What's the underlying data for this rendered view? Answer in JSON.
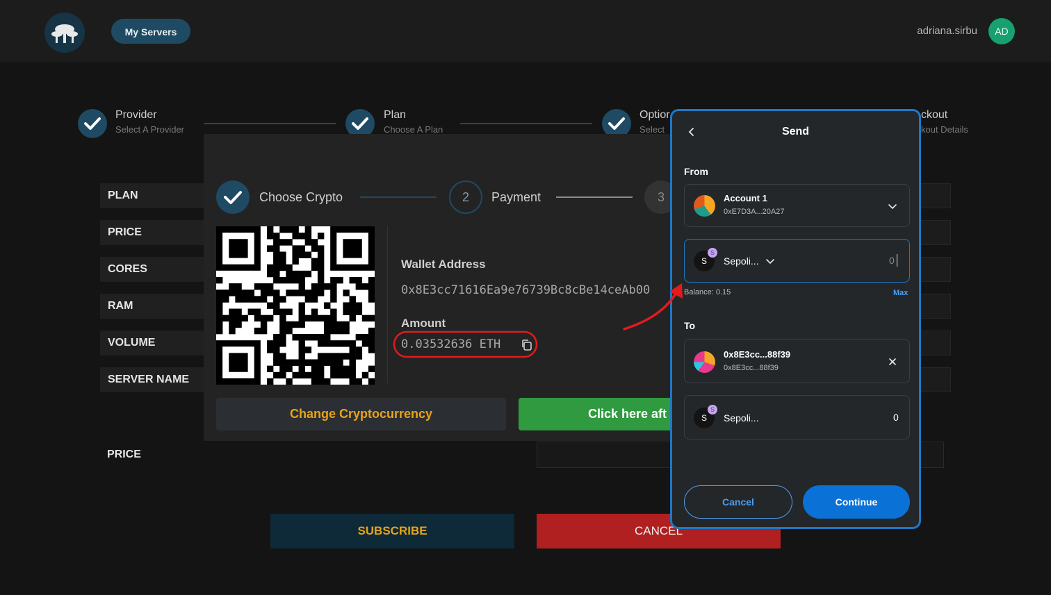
{
  "header": {
    "my_servers": "My Servers",
    "username": "adriana.sirbu",
    "avatar_initials": "AD"
  },
  "stepper": [
    {
      "title": "Provider",
      "subtitle": "Select A Provider"
    },
    {
      "title": "Plan",
      "subtitle": "Choose A Plan"
    },
    {
      "title": "Optior",
      "subtitle": "Select"
    },
    {
      "title": "ckout",
      "subtitle": "kout Details"
    }
  ],
  "form": {
    "rows": [
      "PLAN",
      "PRICE",
      "CORES",
      "RAM",
      "VOLUME",
      "SERVER NAME"
    ],
    "price_label": "PRICE",
    "subscribe": "SUBSCRIBE",
    "cancel": "CANCEL"
  },
  "payment_modal": {
    "steps": [
      {
        "label": "Choose Crypto",
        "marker": "done"
      },
      {
        "label": "Payment",
        "marker": "2"
      },
      {
        "label": "",
        "marker": "3"
      }
    ],
    "wallet_address_label": "Wallet Address",
    "wallet_address": "0x8E3cc71616Ea9e76739Bc8cBe14ceAb00",
    "amount_label": "Amount",
    "amount": "0.03532636 ETH",
    "change_crypto": "Change Cryptocurrency",
    "click_here": "Click here aft"
  },
  "send_panel": {
    "title": "Send",
    "from_label": "From",
    "account_name": "Account 1",
    "account_address": "0xE7D3A...20A27",
    "asset_letter": "S",
    "asset_name": "Sepoli...",
    "amount_value": "0",
    "balance": "Balance: 0.15",
    "max": "Max",
    "to_label": "To",
    "to_name": "0x8E3cc...88f39",
    "to_address": "0x8E3cc...88f39",
    "receive_asset_name": "Sepoli...",
    "receive_amount": "0",
    "cancel": "Cancel",
    "continue": "Continue"
  },
  "colors": {
    "accent_blue": "#1e78c8",
    "step_teal": "#1f4a63",
    "gold": "#e8a317",
    "green": "#2f9a40",
    "red": "#b02020",
    "annotation_red": "#e31b1b"
  }
}
